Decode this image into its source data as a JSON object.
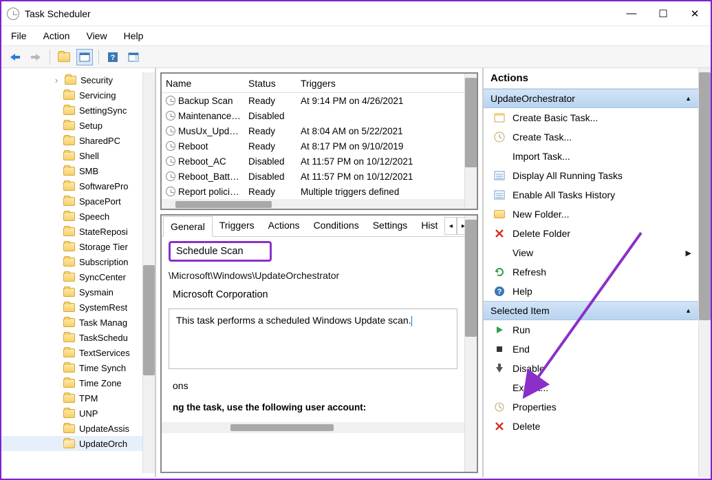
{
  "window": {
    "title": "Task Scheduler"
  },
  "menubar": {
    "file": "File",
    "action": "Action",
    "view": "View",
    "help": "Help"
  },
  "tree": {
    "items": [
      "Security",
      "Servicing",
      "SettingSync",
      "Setup",
      "SharedPC",
      "Shell",
      "SMB",
      "SoftwarePro",
      "SpacePort",
      "Speech",
      "StateReposi",
      "Storage Tier",
      "Subscription",
      "SyncCenter",
      "Sysmain",
      "SystemRest",
      "Task Manag",
      "TaskSchedu",
      "TextServices",
      "Time Synch",
      "Time Zone",
      "TPM",
      "UNP",
      "UpdateAssis",
      "UpdateOrch"
    ],
    "selected_index": 24,
    "expand_marker_index": 0
  },
  "task_list": {
    "columns": [
      "Name",
      "Status",
      "Triggers"
    ],
    "rows": [
      {
        "name": "Backup Scan",
        "status": "Ready",
        "triggers": "At 9:14 PM on 4/26/2021"
      },
      {
        "name": "Maintenance…",
        "status": "Disabled",
        "triggers": ""
      },
      {
        "name": "MusUx_Upd…",
        "status": "Ready",
        "triggers": "At 8:04 AM on 5/22/2021"
      },
      {
        "name": "Reboot",
        "status": "Ready",
        "triggers": "At 8:17 PM on 9/10/2019"
      },
      {
        "name": "Reboot_AC",
        "status": "Disabled",
        "triggers": "At 11:57 PM on 10/12/2021"
      },
      {
        "name": "Reboot_Batt…",
        "status": "Disabled",
        "triggers": "At 11:57 PM on 10/12/2021"
      },
      {
        "name": "Report polici…",
        "status": "Ready",
        "triggers": "Multiple triggers defined"
      }
    ]
  },
  "tabs": {
    "items": [
      "General",
      "Triggers",
      "Actions",
      "Conditions",
      "Settings",
      "Hist"
    ],
    "active_index": 0
  },
  "details": {
    "task_name": "Schedule Scan",
    "path": "\\Microsoft\\Windows\\UpdateOrchestrator",
    "author": "Microsoft Corporation",
    "description": "This task performs a scheduled Windows Update scan.",
    "cutoff_line1": "ons",
    "cutoff_line2": "ng the task, use the following user account:"
  },
  "actions_panel": {
    "title": "Actions",
    "group1": {
      "header": "UpdateOrchestrator",
      "items": [
        {
          "icon": "wizard",
          "label": "Create Basic Task..."
        },
        {
          "icon": "create",
          "label": "Create Task..."
        },
        {
          "icon": "none",
          "label": "Import Task..."
        },
        {
          "icon": "list",
          "label": "Display All Running Tasks"
        },
        {
          "icon": "list",
          "label": "Enable All Tasks History"
        },
        {
          "icon": "folder",
          "label": "New Folder..."
        },
        {
          "icon": "x",
          "label": "Delete Folder"
        },
        {
          "icon": "none",
          "label": "View",
          "submenu": true
        },
        {
          "icon": "refresh",
          "label": "Refresh"
        },
        {
          "icon": "help",
          "label": "Help"
        }
      ]
    },
    "group2": {
      "header": "Selected Item",
      "items": [
        {
          "icon": "run",
          "label": "Run"
        },
        {
          "icon": "end",
          "label": "End"
        },
        {
          "icon": "disable",
          "label": "Disable"
        },
        {
          "icon": "none",
          "label": "Export..."
        },
        {
          "icon": "props",
          "label": "Properties"
        },
        {
          "icon": "x",
          "label": "Delete"
        }
      ]
    }
  }
}
